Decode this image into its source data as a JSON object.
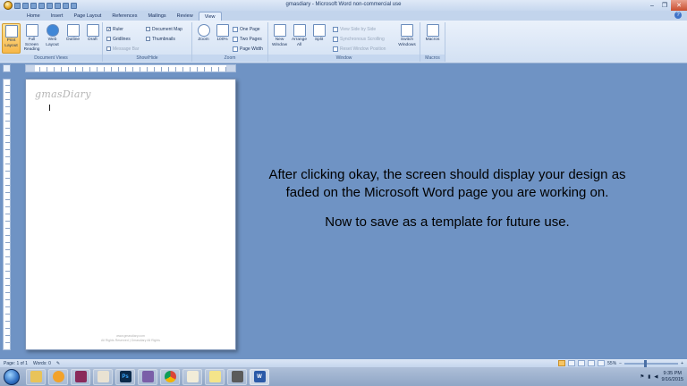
{
  "window": {
    "title": "gmasdiary - Microsoft Word non-commercial use"
  },
  "tabs": [
    "Home",
    "Insert",
    "Page Layout",
    "References",
    "Mailings",
    "Review",
    "View"
  ],
  "active_tab": "View",
  "ribbon": {
    "document_views": {
      "label": "Document Views",
      "buttons": [
        "Print Layout",
        "Full Screen Reading",
        "Web Layout",
        "Outline",
        "Draft"
      ]
    },
    "show_hide": {
      "label": "Show/Hide",
      "ruler": "Ruler",
      "gridlines": "Gridlines",
      "message_bar": "Message Bar",
      "document_map": "Document Map",
      "thumbnails": "Thumbnails"
    },
    "zoom": {
      "label": "Zoom",
      "zoom_button": "Zoom",
      "hundred_button": "100%",
      "one_page": "One Page",
      "two_pages": "Two Pages",
      "page_width": "Page Width"
    },
    "window": {
      "label": "Window",
      "new_window": "New Window",
      "arrange_all": "Arrange All",
      "split": "Split",
      "view_side_by_side": "View Side by Side",
      "sync_scrolling": "Synchronous Scrolling",
      "reset_window_position": "Reset Window Position",
      "switch_windows": "Switch Windows"
    },
    "macros": {
      "label": "Macros",
      "macros_button": "Macros"
    }
  },
  "document": {
    "header_text": "gmasDiary",
    "footer_line1": "www.gmasdiary.com",
    "footer_line2": "All Rights Reserved | Gmasdiary All Rights"
  },
  "instructions": {
    "line1": "After clicking okay, the screen should display your design as faded on the Microsoft Word page you are working on.",
    "line2": "Now to save as a template for future use."
  },
  "statusbar": {
    "page": "Page: 1 of 1",
    "words": "Words: 0",
    "zoom": "55%"
  },
  "clock": {
    "time": "9:35 PM",
    "date": "9/16/2015"
  },
  "colors": {
    "workspace": "#6f93c4",
    "ribbon": "#dfe9f7",
    "accent_selected": "#f7b84a"
  }
}
